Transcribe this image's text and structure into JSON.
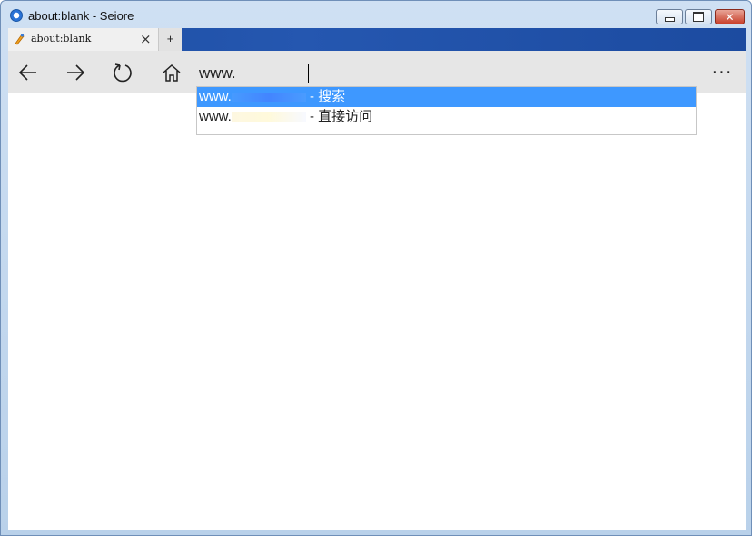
{
  "window": {
    "title": "about:blank - Seiore",
    "buttons": {
      "close": "✕"
    }
  },
  "tabs": {
    "active_title": "about:blank",
    "close": "×",
    "new_tab": "+"
  },
  "toolbar": {
    "address_value": "www.",
    "more": "···"
  },
  "autocomplete": {
    "items": [
      {
        "prefix": "www.",
        "suffix": "- 搜索",
        "selected": true
      },
      {
        "prefix": "www.",
        "suffix": "- 直接访问",
        "selected": false
      }
    ]
  },
  "colors": {
    "tab_strip": "#1d4ea3",
    "selected_suggestion": "#3e98ff",
    "toolbar": "#e6e6e6"
  },
  "icons": [
    "app-icon",
    "tab-favicon-icon",
    "back-arrow-icon",
    "forward-arrow-icon",
    "refresh-icon",
    "home-icon",
    "more-options-icon"
  ]
}
